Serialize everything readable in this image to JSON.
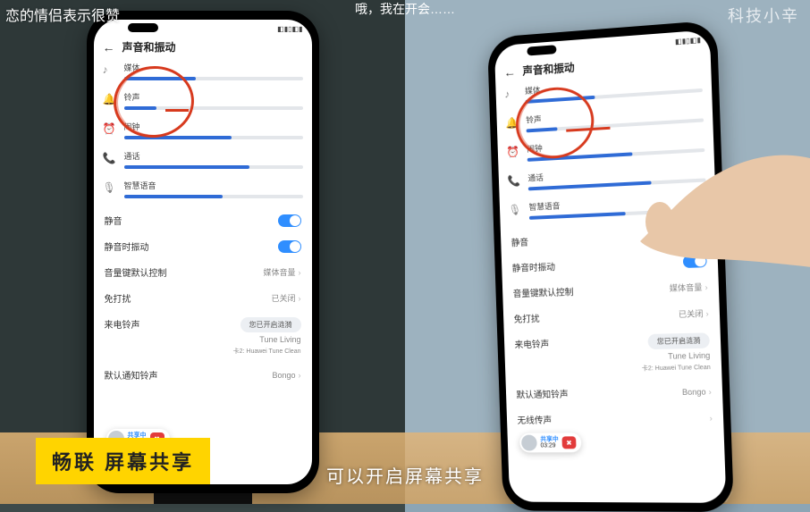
{
  "captions": {
    "top_left": "恋的情侣表示很赞",
    "top_mid": "哦，我在开会……",
    "top_right_watermark": "科技小辛",
    "bottom_mid": "可以开启屏幕共享",
    "feature_badge": "畅联 屏幕共享"
  },
  "phone": {
    "header": {
      "back_icon": "←",
      "title": "声音和振动"
    },
    "sliders": [
      {
        "icon": "♪",
        "label": "媒体",
        "fill_pct": 40
      },
      {
        "icon": "🔔",
        "label": "铃声",
        "fill_pct": 18
      },
      {
        "icon": "⏰",
        "label": "闹钟",
        "fill_pct": 60
      },
      {
        "icon": "📞",
        "label": "通话",
        "fill_pct": 70
      },
      {
        "icon": "🎙",
        "label": "智慧语音",
        "fill_pct": 55
      }
    ],
    "rows": {
      "mute": {
        "label": "静音",
        "type": "toggle",
        "on": true
      },
      "vibrate_on_mute": {
        "label": "静音时振动",
        "type": "toggle",
        "on": true
      },
      "vol_key_ctrl": {
        "label": "音量键默认控制",
        "value": "媒体音量"
      },
      "dnd": {
        "label": "免打扰",
        "value": "已关闭"
      },
      "ringtone": {
        "label": "来电铃声",
        "bubble": "您已开启涟漪",
        "value_line1": "Tune Living",
        "value_line2": "卡2: Huawei Tune Clean"
      },
      "notif_tone": {
        "label": "默认通知铃声",
        "value": "Bongo"
      },
      "wireless": {
        "label": "无线传声",
        "value": ""
      }
    },
    "call_pill": {
      "status": "共享中",
      "time": "03:29",
      "end_icon": "✖"
    }
  }
}
